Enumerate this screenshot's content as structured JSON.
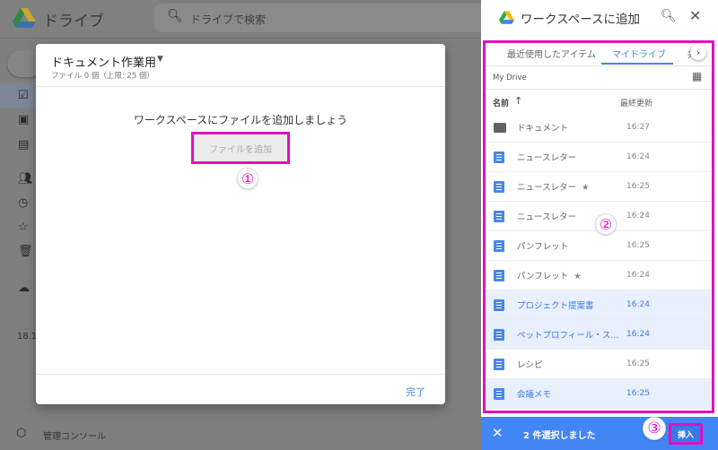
{
  "drive": {
    "title": "ドライブ",
    "search_placeholder": "ドライブで検索",
    "storage": "18.1",
    "admin_console": "管理コンソール"
  },
  "dialog": {
    "title": "ドキュメント作業用",
    "subtitle": "ファイル 0 個（上限: 25 個）",
    "message": "ワークスペースにファイルを追加しましょう",
    "add_file": "ファイルを追加",
    "done": "完了"
  },
  "steps": {
    "one": "①",
    "two": "②",
    "three": "③"
  },
  "panel": {
    "title": "ワークスペースに追加",
    "tabs": [
      "最近使用したアイテム",
      "マイドライブ",
      "共有"
    ],
    "active_tab": "マイドライブ",
    "breadcrumb": "My Drive",
    "col_name": "名前",
    "sort_icon": "↑",
    "col_modified": "最終更新",
    "rows": [
      {
        "name": "ドキュメント",
        "time": "16:27",
        "type": "folder",
        "starred": false,
        "selected": false
      },
      {
        "name": "ニュースレター",
        "time": "16:24",
        "type": "doc",
        "starred": false,
        "selected": false
      },
      {
        "name": "ニュースレター",
        "time": "16:25",
        "type": "doc",
        "starred": true,
        "selected": false
      },
      {
        "name": "ニュースレター",
        "time": "16:24",
        "type": "doc",
        "starred": false,
        "selected": false
      },
      {
        "name": "パンフレット",
        "time": "16:25",
        "type": "doc",
        "starred": false,
        "selected": false
      },
      {
        "name": "パンフレット",
        "time": "16:24",
        "type": "doc",
        "starred": true,
        "selected": false
      },
      {
        "name": "プロジェクト提案書",
        "time": "16:24",
        "type": "doc",
        "starred": false,
        "selected": true
      },
      {
        "name": "ペットプロフィール・ス...",
        "time": "16:24",
        "type": "doc",
        "starred": false,
        "selected": true
      },
      {
        "name": "レシピ",
        "time": "16:25",
        "type": "doc",
        "starred": false,
        "selected": false
      },
      {
        "name": "会議メモ",
        "time": "16:25",
        "type": "doc",
        "starred": false,
        "selected": true
      }
    ],
    "selection": "2 件選択しました",
    "insert": "挿入"
  },
  "colors": {
    "accent": "#4285f4",
    "highlight": "#e010c0",
    "selected_row": "#e8f0fe"
  }
}
